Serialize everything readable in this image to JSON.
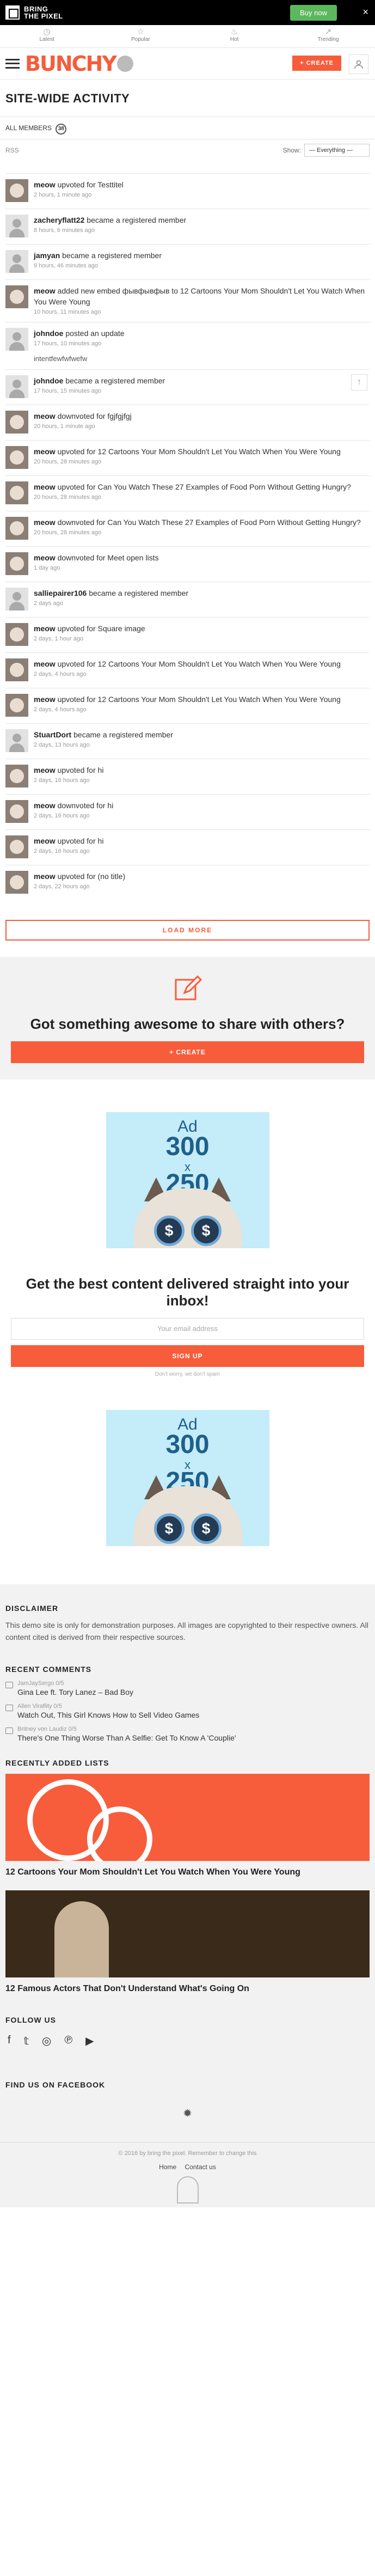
{
  "promo": {
    "brand_line1": "BRING",
    "brand_line2": "THE PIXEL",
    "buy_label": "Buy now",
    "close": "×"
  },
  "nav": [
    {
      "icon": "clock-icon",
      "glyph": "◷",
      "label": "Latest"
    },
    {
      "icon": "star-icon",
      "glyph": "☆",
      "label": "Popular"
    },
    {
      "icon": "flame-icon",
      "glyph": "♨",
      "label": "Hot"
    },
    {
      "icon": "trending-icon",
      "glyph": "↗",
      "label": "Trending"
    }
  ],
  "header": {
    "logo": "BUNCHY",
    "create_label": "+ CREATE"
  },
  "page": {
    "title": "SITE-WIDE ACTIVITY",
    "tab_label": "ALL MEMBERS",
    "member_count": "38",
    "rss": "RSS",
    "show_label": "Show:",
    "show_value": "— Everything —"
  },
  "activities": [
    {
      "avatar": "cat",
      "user": "meow",
      "action": "upvoted for",
      "target": "Testtitel",
      "time": "2 hours, 1 minute ago"
    },
    {
      "avatar": "def",
      "user": "zacheryflatt22",
      "action": "became a registered member",
      "target": "",
      "time": "8 hours, 6 minutes ago"
    },
    {
      "avatar": "def",
      "user": "jamyan",
      "action": "became a registered member",
      "target": "",
      "time": "9 hours, 46 minutes ago"
    },
    {
      "avatar": "cat",
      "user": "meow",
      "action": "added new embed",
      "target": "фывфывфыв to 12 Cartoons Your Mom Shouldn't Let You Watch When You Were Young",
      "time": "10 hours, 11 minutes ago"
    },
    {
      "avatar": "def",
      "user": "johndoe",
      "action": "posted an update",
      "target": "",
      "time": "17 hours, 10 minutes ago",
      "extra": "intentfewfwfwefw"
    },
    {
      "avatar": "def",
      "user": "johndoe",
      "action": "became a registered member",
      "target": "",
      "time": "17 hours, 15 minutes ago"
    },
    {
      "avatar": "cat",
      "user": "meow",
      "action": "downvoted for",
      "target": "fgjfgjfgj",
      "time": "20 hours, 1 minute ago"
    },
    {
      "avatar": "cat",
      "user": "meow",
      "action": "upvoted for",
      "target": "12 Cartoons Your Mom Shouldn't Let You Watch When You Were Young",
      "time": "20 hours, 28 minutes ago"
    },
    {
      "avatar": "cat",
      "user": "meow",
      "action": "upvoted for",
      "target": "Can You Watch These 27 Examples of Food Porn Without Getting Hungry?",
      "time": "20 hours, 28 minutes ago"
    },
    {
      "avatar": "cat",
      "user": "meow",
      "action": "downvoted for",
      "target": "Can You Watch These 27 Examples of Food Porn Without Getting Hungry?",
      "time": "20 hours, 28 minutes ago"
    },
    {
      "avatar": "cat",
      "user": "meow",
      "action": "downvoted for",
      "target": "Meet open lists",
      "time": "1 day ago"
    },
    {
      "avatar": "def",
      "user": "salliepairer106",
      "action": "became a registered member",
      "target": "",
      "time": "2 days ago"
    },
    {
      "avatar": "cat",
      "user": "meow",
      "action": "upvoted for",
      "target": "Square image",
      "time": "2 days, 1 hour ago"
    },
    {
      "avatar": "cat",
      "user": "meow",
      "action": "upvoted for",
      "target": "12 Cartoons Your Mom Shouldn't Let You Watch When You Were Young",
      "time": "2 days, 4 hours ago"
    },
    {
      "avatar": "cat",
      "user": "meow",
      "action": "upvoted for",
      "target": "12 Cartoons Your Mom Shouldn't Let You Watch When You Were Young",
      "time": "2 days, 4 hours ago"
    },
    {
      "avatar": "def",
      "user": "StuartDort",
      "action": "became a registered member",
      "target": "",
      "time": "2 days, 13 hours ago"
    },
    {
      "avatar": "cat",
      "user": "meow",
      "action": "upvoted for",
      "target": "hi",
      "time": "2 days, 16 hours ago"
    },
    {
      "avatar": "cat",
      "user": "meow",
      "action": "downvoted for",
      "target": "hi",
      "time": "2 days, 16 hours ago"
    },
    {
      "avatar": "cat",
      "user": "meow",
      "action": "upvoted for",
      "target": "hi",
      "time": "2 days, 16 hours ago"
    },
    {
      "avatar": "cat",
      "user": "meow",
      "action": "upvoted for",
      "target": "(no title)",
      "time": "2 days, 22 hours ago"
    }
  ],
  "load_more": "LOAD MORE",
  "cta": {
    "title": "Got something awesome to share with others?",
    "button": "+ CREATE"
  },
  "ad": {
    "l1": "Ad",
    "l2": "300",
    "l3": "x",
    "l4": "250",
    "coin": "$"
  },
  "newsletter": {
    "title": "Get the best content delivered straight into your inbox!",
    "placeholder": "Your email address",
    "button": "SIGN UP",
    "note": "Don't worry, we don't spam"
  },
  "footer": {
    "disclaimer_title": "DISCLAIMER",
    "disclaimer_text": "This demo site is only for demonstration purposes. All images are copyrighted to their respective owners. All content cited is derived from their respective sources.",
    "comments_title": "RECENT COMMENTS",
    "comments": [
      {
        "who": "JamJaySergo 0/5",
        "what": "Gina Lee ft. Tory Lanez – Bad Boy"
      },
      {
        "who": "Allen Viraflity 0/5",
        "what": "Watch Out, This Girl Knows How to Sell Video Games"
      },
      {
        "who": "Britney von Laudiz 0/5",
        "what": "There's One Thing Worse Than A Selfie: Get To Know A 'Couplie'"
      }
    ],
    "lists_title": "RECENTLY ADDED LISTS",
    "lists": [
      {
        "title": "12 Cartoons Your Mom Shouldn't Let You Watch When You Were Young"
      },
      {
        "title": "12 Famous Actors That Don't Understand What's Going On"
      }
    ],
    "follow_title": "FOLLOW US",
    "social": [
      {
        "icon": "facebook-icon",
        "glyph": "f"
      },
      {
        "icon": "twitter-icon",
        "glyph": "𝕥"
      },
      {
        "icon": "instagram-icon",
        "glyph": "◎"
      },
      {
        "icon": "pinterest-icon",
        "glyph": "℗"
      },
      {
        "icon": "youtube-icon",
        "glyph": "▶"
      }
    ],
    "fb_title": "FIND US ON FACEBOOK",
    "spinner": "✹",
    "copyright": "© 2016 by bring the pixel. Remember to change this",
    "links": [
      "Home",
      "Contact us"
    ]
  }
}
